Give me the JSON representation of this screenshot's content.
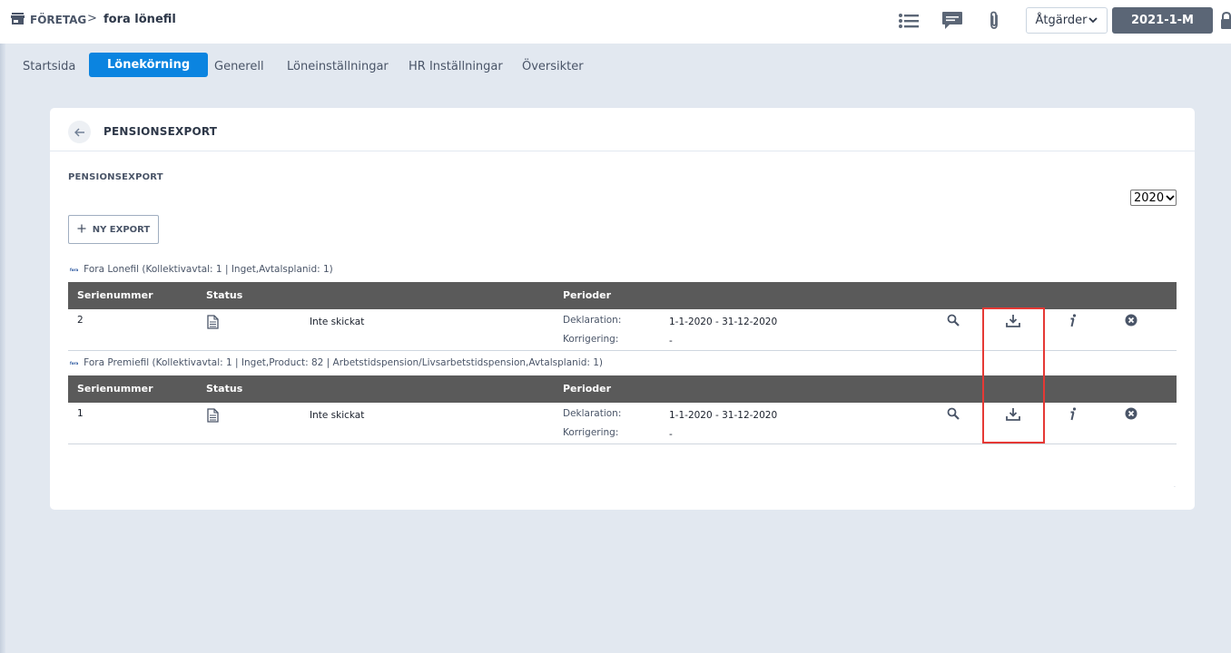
{
  "breadcrumb": {
    "company": "FÖRETAG",
    "separator": ">",
    "page": "fora lönefil"
  },
  "toolbar": {
    "actions_label": "Åtgärder",
    "period_label": "2021-1-M",
    "icons": [
      "list-icon",
      "chat-icon",
      "paperclip-icon",
      "chevron-down-icon",
      "lock-icon"
    ]
  },
  "tabs": [
    {
      "label": "Startsida",
      "active": false
    },
    {
      "label": "Lönekörning",
      "active": true
    },
    {
      "label": "Generell",
      "active": false
    },
    {
      "label": "Löneinställningar",
      "active": false
    },
    {
      "label": "HR Inställningar",
      "active": false
    },
    {
      "label": "Översikter",
      "active": false
    }
  ],
  "card": {
    "title": "PENSIONSEXPORT",
    "section_title": "PENSIONSEXPORT",
    "year_select": "2020",
    "new_export_label": "NY EXPORT",
    "logo_text": "fora",
    "columns": {
      "serial": "Serienummer",
      "status": "Status",
      "periods": "Perioder"
    },
    "groups": [
      {
        "label": "Fora Lonefil (Kollektivavtal: 1 | Inget,Avtalsplanid: 1)",
        "rows": [
          {
            "serial": "2",
            "status": "Inte skickat",
            "declaration_label": "Deklaration:",
            "declaration_value": "1-1-2020 - 31-12-2020",
            "correction_label": "Korrigering:",
            "correction_value": "-"
          }
        ]
      },
      {
        "label": "Fora Premiefil (Kollektivavtal: 1 | Inget,Product: 82 | Arbetstidspension/Livsarbetstidspension,Avtalsplanid: 1)",
        "rows": [
          {
            "serial": "1",
            "status": "Inte skickat",
            "declaration_label": "Deklaration:",
            "declaration_value": "1-1-2020 - 31-12-2020",
            "correction_label": "Korrigering:",
            "correction_value": "-"
          }
        ]
      }
    ],
    "footer_mark": "."
  },
  "colors": {
    "accent": "#0b84e0",
    "period_button": "#5b6676",
    "table_header": "#5a5a5a",
    "highlight": "#e53935",
    "background": "#e2e8f0"
  }
}
